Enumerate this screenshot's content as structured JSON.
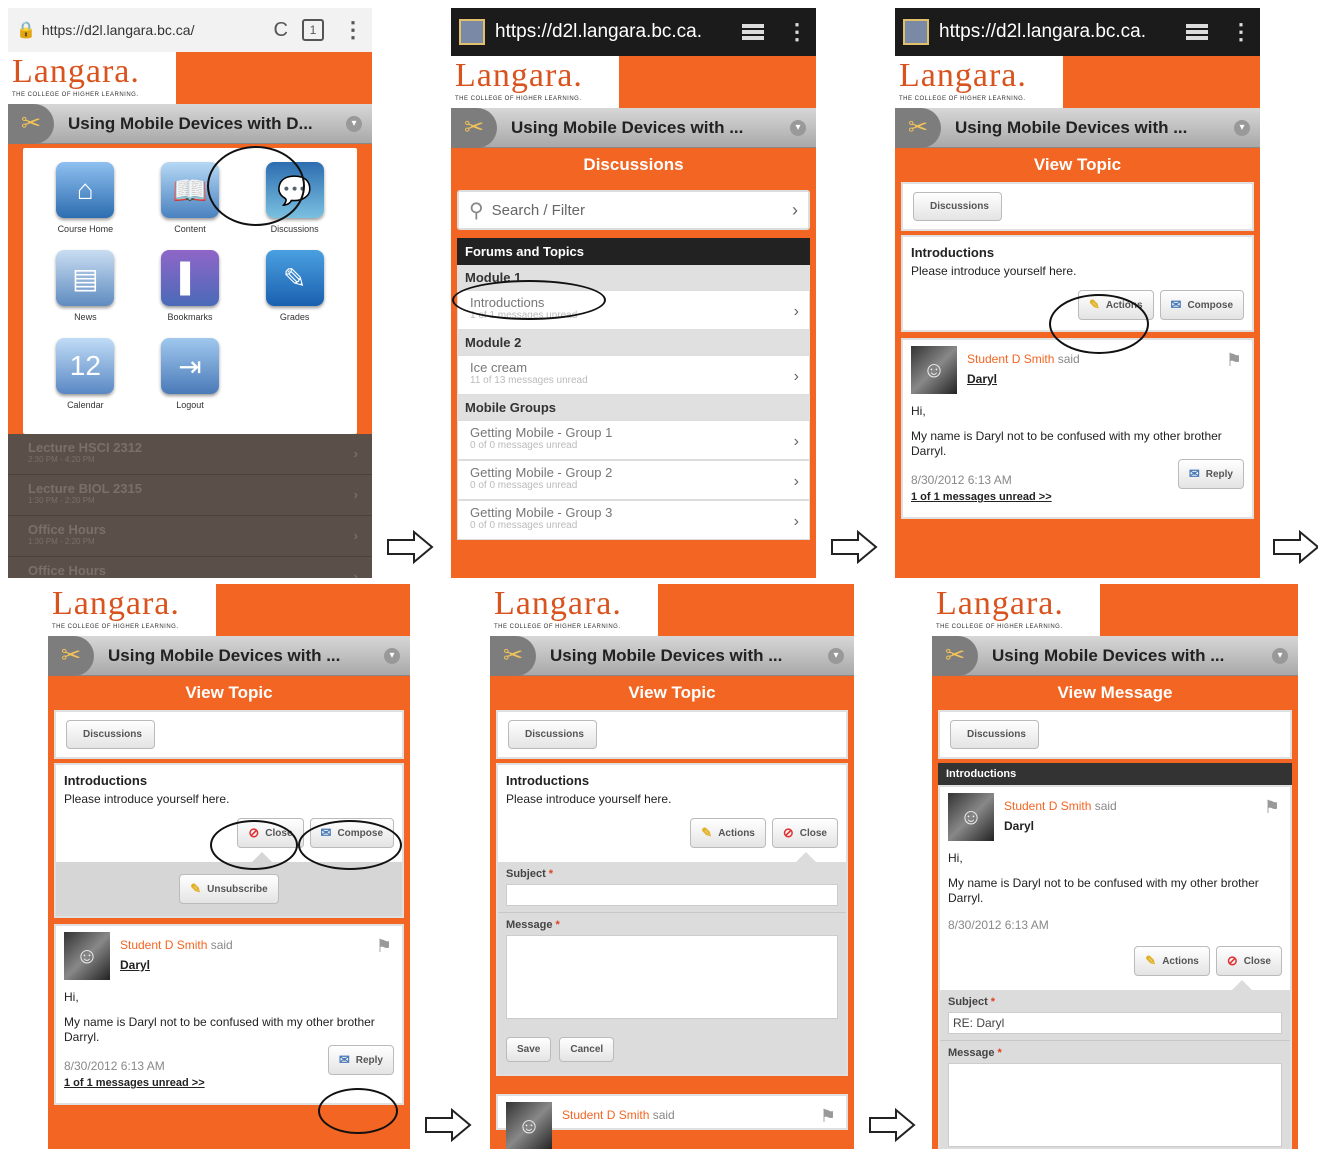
{
  "common": {
    "logo": "Langara.",
    "logo_tagline": "THE COLLEGE OF HIGHER LEARNING.",
    "course_title_short": "Using Mobile Devices with D...",
    "course_title": "Using Mobile Devices with ...",
    "back_label": "Discussions",
    "url": "https://d2l.langara.bc.ca.",
    "url_light": "https://d2l.langara.bc.ca/",
    "tabs_count": "1"
  },
  "screen1": {
    "grid": [
      {
        "label": "Course Home",
        "icon": "home-icon",
        "glyph": "⌂"
      },
      {
        "label": "Content",
        "icon": "book-icon",
        "glyph": "📖"
      },
      {
        "label": "Discussions",
        "icon": "discussion-bubble-icon",
        "glyph": "💬"
      },
      {
        "label": "News",
        "icon": "news-icon",
        "glyph": "▤"
      },
      {
        "label": "Bookmarks",
        "icon": "bookmark-icon",
        "glyph": "▌"
      },
      {
        "label": "Grades",
        "icon": "ruler-icon",
        "glyph": "✎"
      },
      {
        "label": "Calendar",
        "icon": "calendar-icon",
        "glyph": "12"
      },
      {
        "label": "Logout",
        "icon": "logout-icon",
        "glyph": "⇥"
      }
    ],
    "underlay": [
      {
        "title": "Lecture HSCI 2312",
        "sub": "2:30 PM - 4:20 PM"
      },
      {
        "title": "Lecture BIOL 2315",
        "sub": "1:30 PM - 2:20 PM"
      },
      {
        "title": "Office Hours",
        "sub": "1:30 PM - 2:20 PM"
      },
      {
        "title": "Office Hours",
        "sub": ""
      }
    ]
  },
  "screen2": {
    "header": "Discussions",
    "search_placeholder": "Search / Filter",
    "forums_header": "Forums and Topics",
    "groups": [
      {
        "name": "Module 1",
        "items": [
          {
            "title": "Introductions",
            "sub": "1 of 1 messages unread"
          }
        ]
      },
      {
        "name": "Module 2",
        "items": [
          {
            "title": "Ice cream",
            "sub": "11 of 13 messages unread"
          }
        ]
      },
      {
        "name": "Mobile Groups",
        "items": [
          {
            "title": "Getting Mobile - Group 1",
            "sub": "0 of 0 messages unread"
          },
          {
            "title": "Getting Mobile - Group 2",
            "sub": "0 of 0 messages unread"
          },
          {
            "title": "Getting Mobile - Group 3",
            "sub": "0 of 0 messages unread"
          }
        ]
      }
    ]
  },
  "topic": {
    "header": "View Topic",
    "title": "Introductions",
    "desc": "Please introduce yourself here.",
    "actions": "Actions",
    "compose": "Compose",
    "close": "Close",
    "unsubscribe": "Unsubscribe",
    "reply": "Reply"
  },
  "post": {
    "author": "Student D Smith",
    "said": "said",
    "subject": "Daryl",
    "greeting": "Hi,",
    "body": "My name is Daryl not to be confused with my other brother Darryl.",
    "date": "8/30/2012 6:13 AM",
    "unread": "1 of 1 messages unread >>"
  },
  "form": {
    "subject_label": "Subject",
    "message_label": "Message",
    "required": "*",
    "save": "Save",
    "cancel": "Cancel",
    "reply_subject_value": "RE: Daryl"
  },
  "screen6": {
    "header": "View Message"
  }
}
